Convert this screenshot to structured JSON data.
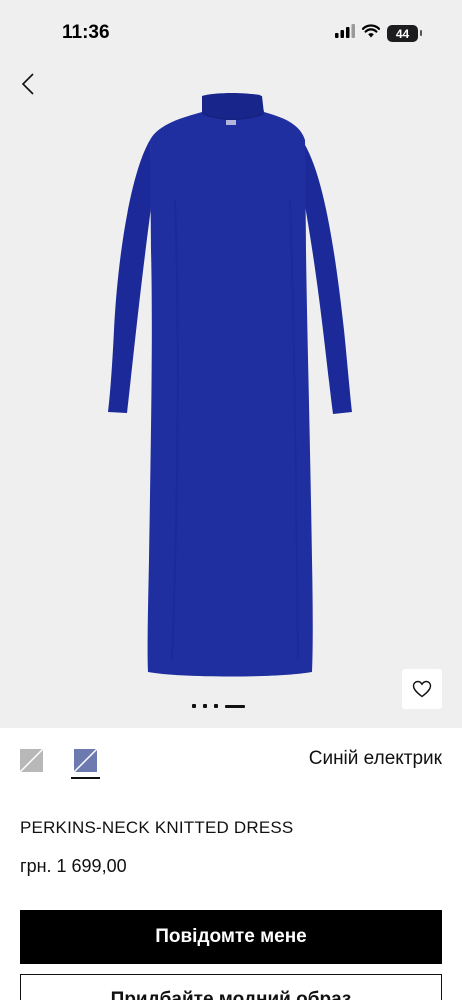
{
  "status_bar": {
    "time": "11:36",
    "battery": "44"
  },
  "colors": {
    "product": "#1f2fa0",
    "background": "#efefef",
    "button": "#000000"
  },
  "gallery": {
    "pages": 4,
    "active_page": 4
  },
  "color_picker": {
    "swatches": [
      {
        "name": "grey",
        "color": "#b8b8b8"
      },
      {
        "name": "electric-blue",
        "color": "#6d7ab0",
        "selected": true
      }
    ],
    "selected_color_name": "Синій електрик"
  },
  "product": {
    "title": "PERKINS-NECK KNITTED DRESS",
    "price": "грн. 1 699,00"
  },
  "actions": {
    "notify_label": "Повідомте мене",
    "secondary_label": "Придбайте модний образ"
  }
}
